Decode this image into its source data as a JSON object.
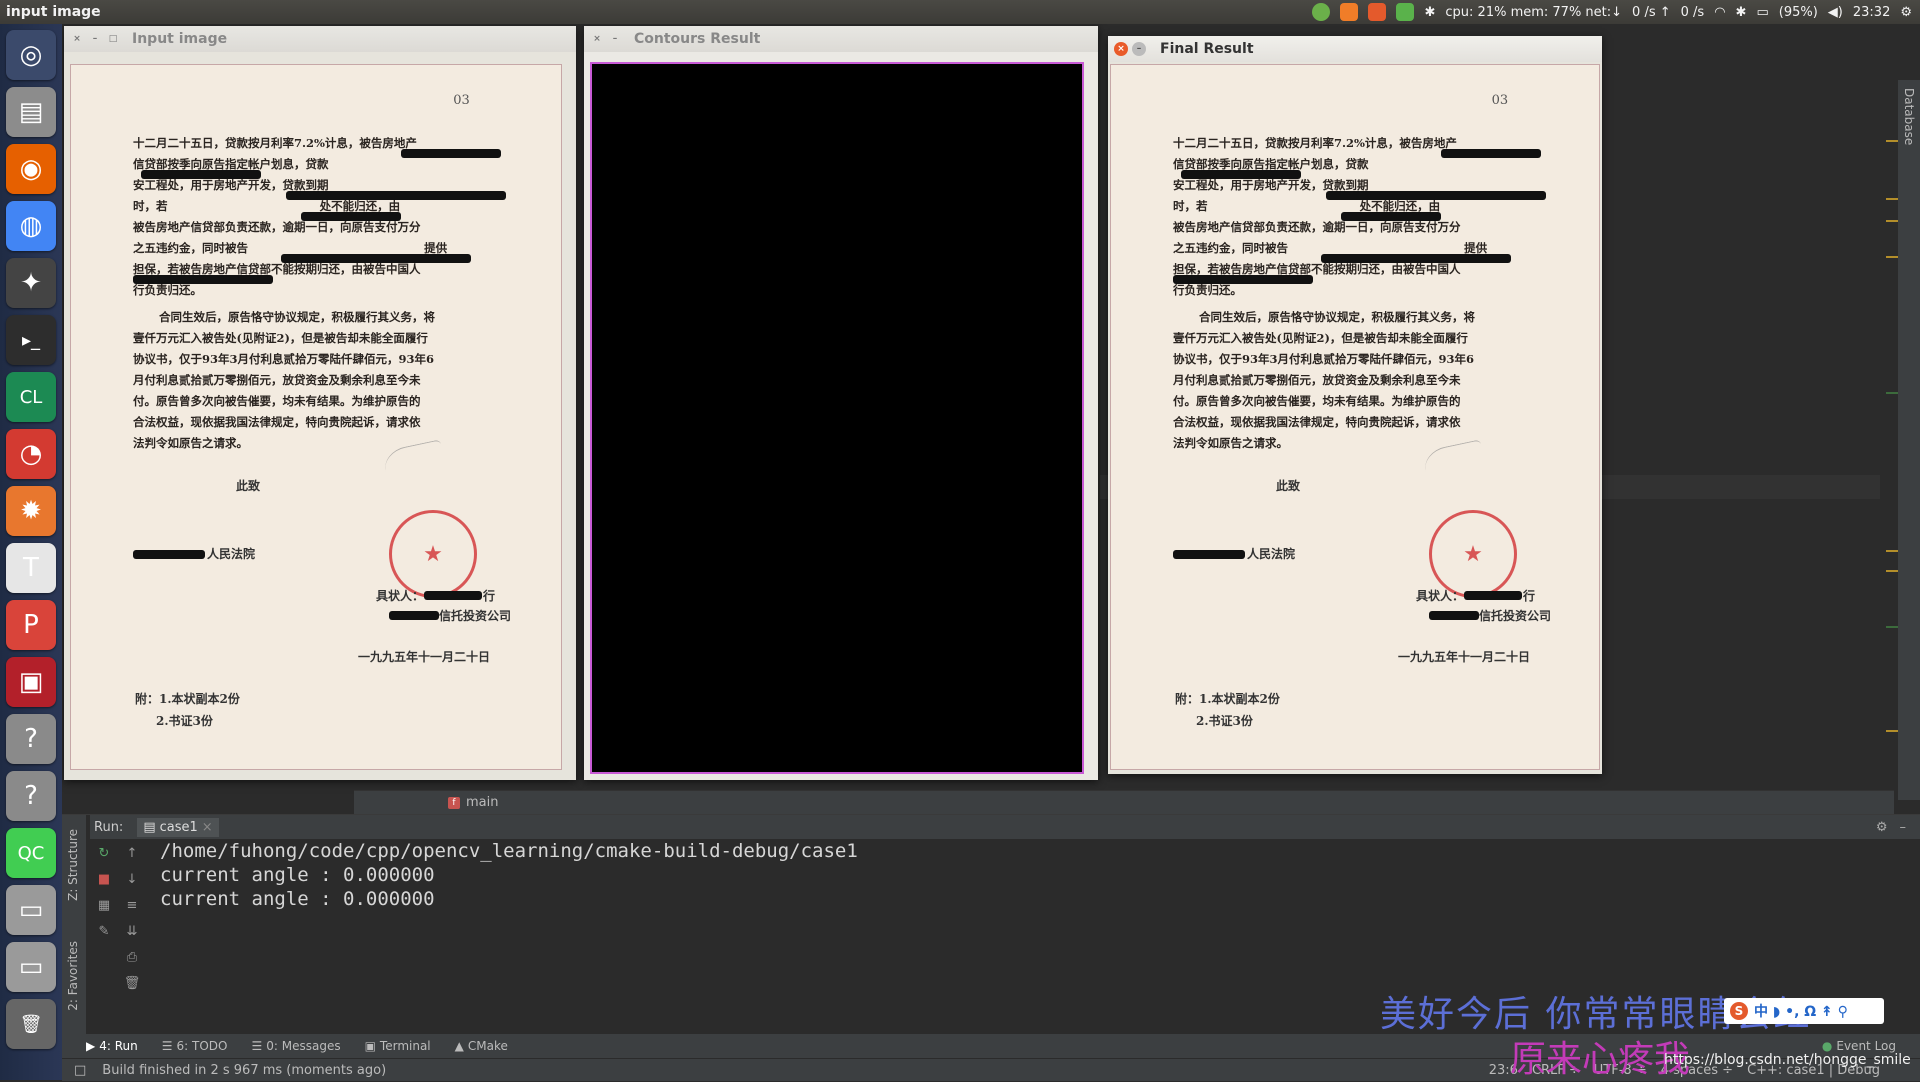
{
  "top_panel": {
    "title": "input image",
    "sysinfo": "cpu: 21% mem: 77% net:↓",
    "net_up": "0 /s ↑",
    "net_down": "0 /s",
    "battery": "(95%)",
    "clock": "23:32"
  },
  "launcher": {
    "items": [
      {
        "name": "ubuntu-dash-icon",
        "glyph": "◎",
        "color": "#3b4a6b"
      },
      {
        "name": "files-icon",
        "glyph": "▤",
        "color": "#8c8c8c"
      },
      {
        "name": "firefox-icon",
        "glyph": "◉",
        "color": "#e66000"
      },
      {
        "name": "chrome-icon",
        "glyph": "◍",
        "color": "#4285f4"
      },
      {
        "name": "java-ide-icon",
        "glyph": "✦",
        "color": "#444"
      },
      {
        "name": "terminal-icon",
        "glyph": "▸_",
        "color": "#2d2d2d"
      },
      {
        "name": "clion-icon",
        "glyph": "CL",
        "color": "#1c8a53"
      },
      {
        "name": "netease-music-icon",
        "glyph": "◔",
        "color": "#d33a31"
      },
      {
        "name": "settings-icon",
        "glyph": "✹",
        "color": "#e8772e"
      },
      {
        "name": "typora-icon",
        "glyph": "T",
        "color": "#e6e6e6"
      },
      {
        "name": "wps-presentation-icon",
        "glyph": "P",
        "color": "#d9443a"
      },
      {
        "name": "screen-record-icon",
        "glyph": "▣",
        "color": "#b3202a"
      },
      {
        "name": "unknown-app-icon-1",
        "glyph": "?",
        "color": "#8a8a8a"
      },
      {
        "name": "unknown-app-icon-2",
        "glyph": "?",
        "color": "#8a8a8a"
      },
      {
        "name": "qtcreator-icon",
        "glyph": "QC",
        "color": "#41cd52"
      },
      {
        "name": "drive-icon-1",
        "glyph": "▭",
        "color": "#9a9a9a"
      },
      {
        "name": "drive-icon-2",
        "glyph": "▭",
        "color": "#9a9a9a"
      },
      {
        "name": "trash-icon",
        "glyph": "🗑",
        "color": "#666"
      }
    ]
  },
  "windows": {
    "input": {
      "title": "Input image"
    },
    "contours": {
      "title": "Contours Result"
    },
    "final": {
      "title": "Final Result"
    }
  },
  "document": {
    "page_mark": "03",
    "paragraph1": [
      "十二月二十五日，贷款按月利率7.2%计息，被告房地产",
      "信贷部按季向原告指定帐户划息，贷款",
      "安工程处，用于房地产开发，贷款到期",
      "时，若                                      处不能归还，由",
      "被告房地产信贷部负责还款，逾期一日，向原告支付万分",
      "之五违约金，同时被告                                            提供",
      "担保，若被告房地产信贷部不能按期归还，由被告中国人",
      "行负责归还。"
    ],
    "paragraph2": [
      "合同生效后，原告恪守协议规定，积极履行其义务，将",
      "壹仟万元汇入被告处(见附证2)，但是被告却未能全面履行",
      "协议书，仅于93年3月付利息贰拾万零陆仟肆佰元，93年6",
      "月付利息贰拾贰万零捌佰元，放贷资金及剩余利息至今未",
      "付。原告曾多次向被告催要，均未有结果。为维护原告的",
      "合法权益，现依据我国法律规定，特向贵院起诉，请求依",
      "法判令如原告之请求。"
    ],
    "closing": "此致",
    "court": "人民法院",
    "signature_line1": "具状人：",
    "signature_line1_tail": "行",
    "signature_line2": "信托投资公司",
    "date": "一九九五年十一月二十日",
    "attach1": "附：1.本状副本2份",
    "attach2": "2.书证3份",
    "stamp_glyph": "★"
  },
  "ide": {
    "right_sidebar_label": "Database",
    "breadcrumb": "main",
    "breadcrumb_badge": "f",
    "run_label": "Run:",
    "run_tab": "case1",
    "console_lines": [
      "/home/fuhong/code/cpp/opencv_learning/cmake-build-debug/case1",
      "current angle : 0.000000",
      "current angle : 0.000000"
    ],
    "left_strip_labels": [
      "Z: Structure",
      "2: Favorites"
    ],
    "bottom_tabs": [
      "4: Run",
      "6: TODO",
      "0: Messages",
      "Terminal",
      "CMake"
    ],
    "event_log": "Event Log",
    "status_message": "Build finished in 2 s 967 ms (moments ago)",
    "status_right": [
      "23:6",
      "CRLF ÷",
      "UTF-8 ÷",
      "4 spaces ÷",
      "C++: case1 | Debug"
    ]
  },
  "overlay": {
    "watermark_line1": "美好今后  你常常眼睛会红",
    "watermark_line2": "原来心疼我",
    "ime_text": "中 ◗ •, Ω ↟ ⚲",
    "blog_url": "https://blog.csdn.net/hongge_smile"
  }
}
